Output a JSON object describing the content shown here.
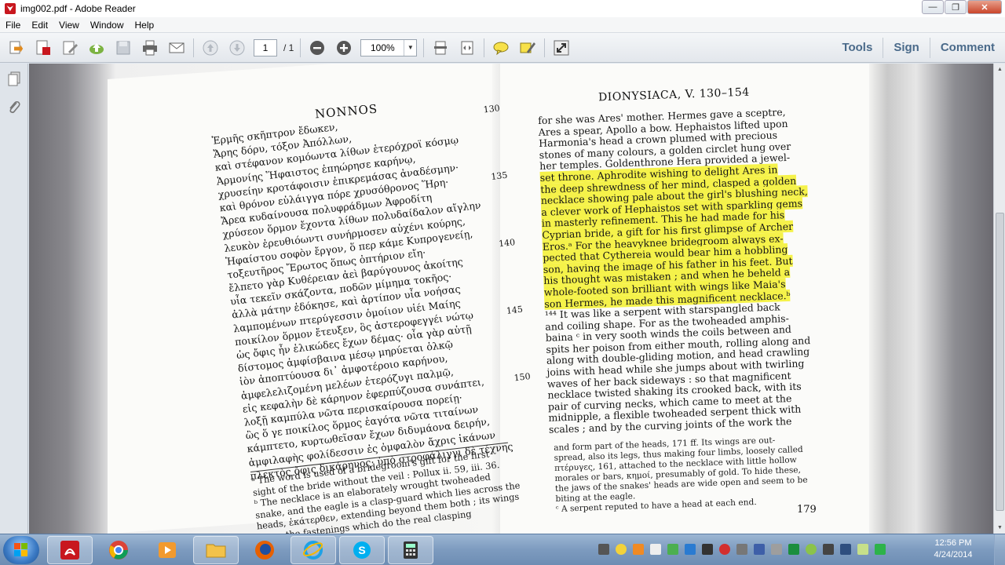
{
  "window": {
    "title": "img002.pdf - Adobe Reader",
    "controls": {
      "minimize": "—",
      "maximize": "❐",
      "close": "✕"
    }
  },
  "menu": [
    "File",
    "Edit",
    "View",
    "Window",
    "Help"
  ],
  "toolbar": {
    "page_current": "1",
    "page_total": "/ 1",
    "zoom": "100%",
    "links": [
      "Tools",
      "Sign",
      "Comment"
    ],
    "icons": [
      "create-pdf-icon",
      "export-pdf-icon",
      "edit-icon",
      "upload-icon",
      "save-icon",
      "print-icon",
      "email-icon",
      "prev-page-icon",
      "next-page-icon",
      "zoom-out-icon",
      "zoom-in-icon",
      "fit-page-icon",
      "fit-width-icon",
      "comment-icon",
      "highlight-icon",
      "fullscreen-icon"
    ]
  },
  "document": {
    "left": {
      "header": "NONNOS",
      "lines": [
        {
          "t": "Ἑρμῆς σκῆπτρον ἔδωκεν,",
          "n": "130"
        },
        {
          "t": "Ἄρης δόρυ, τόξον Ἀπόλλων,",
          "n": ""
        },
        {
          "t": "καὶ στέφανον κομόωντα λίθων ἑτερόχροϊ κόσμῳ",
          "n": ""
        },
        {
          "t": "Ἁρμονίης Ἥφαιστος ἐπηώρησε καρήνῳ,",
          "n": ""
        },
        {
          "t": "χρυσείην κροτάφοισιν ἐπικρεμάσας ἀναδέσμην·",
          "n": ""
        },
        {
          "t": "καὶ θρόνον εὐλάιγγα πόρε χρυσόθρονος Ἥρη·",
          "n": "135"
        },
        {
          "t": "Ἄρεα κυδαίνουσα πολυφράδμων Ἀφροδίτη",
          "n": ""
        },
        {
          "t": "χρύσεον ὅρμον ἔχοντα λίθων πολυδαίδαλον αἴγλην",
          "n": ""
        },
        {
          "t": "λευκὸν ἐρευθιόωντι συνήρμοσεν αὐχένι κούρης,",
          "n": ""
        },
        {
          "t": "Ἡφαίστου σοφὸν ἔργον, ὅ περ κάμε Κυπρογενείῃ,",
          "n": ""
        },
        {
          "t": "τοξευτῆρος Ἔρωτος ὅπως ὀπτήριον εἴη·",
          "n": "140"
        },
        {
          "t": "ἔλπετο γὰρ Κυθέρειαν ἀεὶ βαρύγουνος ἀκοίτης",
          "n": ""
        },
        {
          "t": "υἷα τεκεῖν σκάζοντα, ποδῶν μίμημα τοκῆος·",
          "n": ""
        },
        {
          "t": "ἀλλὰ μάτην ἐδόκησε, καὶ ἀρτίπον υἷα νοήσας",
          "n": ""
        },
        {
          "t": "λαμπομένων πτερύγεσσιν ὁμοίιον υἱέι Μαίης",
          "n": ""
        },
        {
          "t": "ποικίλον ὅρμον ἔτευξεν, ὃς ἀστεροφεγγέι νώτῳ",
          "n": "145"
        },
        {
          "t": "ὡς ὄφις ἦν ἑλικώδες ἔχων δέμας· οἷα γὰρ αὐτῇ",
          "n": ""
        },
        {
          "t": "δίστομος ἀμφίσβαινα μέσῳ μηρύεται ὁλκῷ",
          "n": ""
        },
        {
          "t": "ἰὸν ἀποπτύουσα δι᾽ ἀμφοτέροιο καρήνου,",
          "n": ""
        },
        {
          "t": "ἀμφελελιζομένη μελέων ἑτερόζυγι παλμῷ,",
          "n": ""
        },
        {
          "t": "εἰς κεφαλὴν δὲ κάρηνον ἐφερπύζουσα συνάπτει,",
          "n": "150"
        },
        {
          "t": "λοξῇ καμπύλα νῶτα περισκαίρουσα πορείῃ·",
          "n": ""
        },
        {
          "t": "ὣς ὅ γε ποικίλος ὅρμος ἑαγότα νῶτα τιταίνων",
          "n": ""
        },
        {
          "t": "κάμπτετο, κυρτωθεῖσαν ἔχων διδυμάονα δειρήν,",
          "n": ""
        },
        {
          "t": "ἀμφιλαφὴς φολίδεσσιν ἐς ὀμφαλὸν ἄχρις ἱκάνων",
          "n": ""
        },
        {
          "t": "πλεκτὸς ὄφις δικάρηνος· ὑπὸ στροφάλιγγι δὲ τέχνης",
          "n": ""
        }
      ],
      "footnotes": [
        "ᵃ The word is used of a bridegroom's gift for the first",
        "sight of the bride without the veil : Pollux ii. 59, iii. 36.",
        "ᵇ The necklace is an elaborately wrought twoheaded",
        "snake, and the eagle is a clasp-guard which lies across the",
        "heads, ἐκάτερθεν, extending beyond them both ; its wings",
        "cover the fastenings which do the real clasping"
      ]
    },
    "right": {
      "header": "DIONYSIACA, V. 130–154",
      "lines": [
        {
          "t": "for she was Ares' mother.  Hermes gave a sceptre,",
          "h": false
        },
        {
          "t": "Ares a spear, Apollo a bow.  Hephaistos lifted upon",
          "h": false
        },
        {
          "t": "Harmonia's head a crown plumed with precious",
          "h": false
        },
        {
          "t": "stones of many colours, a golden circlet hung over",
          "h": false
        },
        {
          "t": "her temples.  Goldenthrone Hera provided a jewel-",
          "h": false
        },
        {
          "t": "set throne.  Aphrodite wishing to delight Ares in",
          "h": true
        },
        {
          "t": "the deep shrewdness of her mind, clasped a golden",
          "h": true
        },
        {
          "t": "necklace showing pale about the girl's blushing neck,",
          "h": true
        },
        {
          "t": "a clever work of Hephaistos set with sparkling gems",
          "h": true
        },
        {
          "t": "in masterly refinement.  This he had made for his",
          "h": true
        },
        {
          "t": "Cyprian bride, a gift for his first glimpse of Archer",
          "h": true
        },
        {
          "t": "Eros.ᵃ  For the heavyknee bridegroom always ex-",
          "h": true
        },
        {
          "t": "pected that Cythereia would bear him a hobbling",
          "h": true
        },
        {
          "t": "son, having the image of his father in his feet.  But",
          "h": true
        },
        {
          "t": "his thought was mistaken ; and when he beheld a",
          "h": true
        },
        {
          "t": "whole-footed son brilliant with wings like Maia's",
          "h": true
        },
        {
          "t": "son Hermes, he made this magnificent necklace.ᵇ",
          "h": true
        },
        {
          "t": "¹⁴⁴ It was like a serpent with starspangled back",
          "h": false
        },
        {
          "t": "and coiling shape.  For as the twoheaded amphis-",
          "h": false
        },
        {
          "t": "baina ᶜ in very sooth winds the coils between and",
          "h": false
        },
        {
          "t": "spits her poison from either mouth, rolling along and",
          "h": false
        },
        {
          "t": "along with double-gliding motion, and head crawling",
          "h": false
        },
        {
          "t": "joins with head while she jumps about with twirling",
          "h": false
        },
        {
          "t": "waves of her back sideways : so that magnificent",
          "h": false
        },
        {
          "t": "necklace twisted shaking its crooked back, with its",
          "h": false
        },
        {
          "t": "pair of curving necks, which came to meet at the",
          "h": false
        },
        {
          "t": "midnipple, a flexible twoheaded serpent thick with",
          "h": false
        },
        {
          "t": "scales ; and by the curving joints of the work the",
          "h": false
        }
      ],
      "footnotes": [
        "and form part of the heads, 171 ff.  Its wings are out-",
        "spread, also its legs, thus making four limbs, loosely called",
        "πτέρυγες, 161, attached to the necklace with little hollow",
        "morales or bars, κημοί, presumably of gold.  To hide these,",
        "the jaws of the snakes' heads are wide open and seem to be",
        "biting at the eagle.",
        "ᶜ A serpent reputed to have a head at each end."
      ],
      "page_number": "179"
    }
  },
  "taskbar": {
    "apps": [
      "adobe-reader-icon",
      "chrome-icon",
      "media-player-icon",
      "file-explorer-icon",
      "firefox-icon",
      "internet-explorer-icon",
      "skype-icon",
      "calculator-icon"
    ],
    "clock_time": "12:56 PM",
    "clock_date": "4/24/2014"
  },
  "colors": {
    "highlight": "#f5f24a",
    "adobe_red": "#c8171e",
    "link_blue": "#4a6a8a"
  }
}
